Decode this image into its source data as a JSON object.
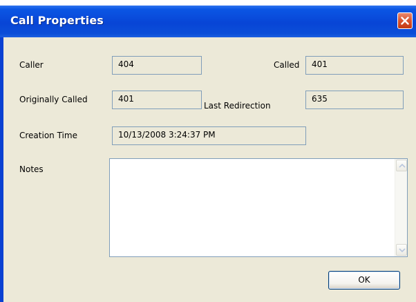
{
  "window": {
    "title": "Call Properties"
  },
  "fields": {
    "caller_label": "Caller",
    "caller_value": "404",
    "called_label": "Called",
    "called_value": "401",
    "originally_called_label": "Originally Called",
    "originally_called_value": "401",
    "last_redirection_label": "Last Redirection",
    "last_redirection_value": "635",
    "creation_time_label": "Creation Time",
    "creation_time_value": "10/13/2008 3:24:37 PM",
    "notes_label": "Notes",
    "notes_value": ""
  },
  "buttons": {
    "ok_label": "OK"
  },
  "icons": {
    "close": "close-x-icon",
    "scroll_up": "scroll-up-arrow-icon",
    "scroll_down": "scroll-down-arrow-icon"
  },
  "colors": {
    "titlebar": "#0845d6",
    "dialog_bg": "#ece9d8",
    "field_border": "#7f9db9",
    "close_button": "#d8532e"
  }
}
